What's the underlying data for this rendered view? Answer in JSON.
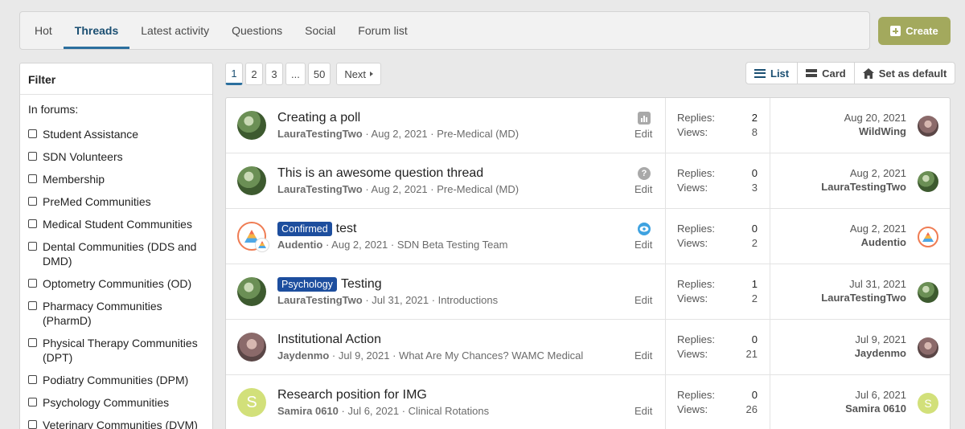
{
  "tabs": [
    {
      "label": "Hot",
      "active": false
    },
    {
      "label": "Threads",
      "active": true
    },
    {
      "label": "Latest activity",
      "active": false
    },
    {
      "label": "Questions",
      "active": false
    },
    {
      "label": "Social",
      "active": false
    },
    {
      "label": "Forum list",
      "active": false
    }
  ],
  "create_label": "Create",
  "filter": {
    "title": "Filter",
    "in_forums_label": "In forums:",
    "forums": [
      "Student Assistance",
      "SDN Volunteers",
      "Membership",
      "PreMed Communities",
      "Medical Student Communities",
      "Dental Communities (DDS and DMD)",
      "Optometry Communities (OD)",
      "Pharmacy Communities (PharmD)",
      "Physical Therapy Communities (DPT)",
      "Podiatry Communities (DPM)",
      "Psychology Communities",
      "Veterinary Communities (DVM)"
    ]
  },
  "pagination": {
    "pages": [
      "1",
      "2",
      "3",
      "...",
      "50"
    ],
    "current": "1",
    "next_label": "Next"
  },
  "view_switch": {
    "list_label": "List",
    "card_label": "Card",
    "default_label": "Set as default"
  },
  "threads": [
    {
      "title": "Creating a poll",
      "prefix": "",
      "author": "LauraTestingTwo",
      "date": "Aug 2, 2021",
      "forum": "Pre-Medical (MD)",
      "status_icon": "poll-icon",
      "edit_label": "Edit",
      "replies_label": "Replies:",
      "replies": "2",
      "views_label": "Views:",
      "views": "8",
      "last_date": "Aug 20, 2021",
      "last_user": "WildWing",
      "avatar": "green",
      "last_avatar": "person"
    },
    {
      "title": "This is an awesome question thread",
      "prefix": "",
      "author": "LauraTestingTwo",
      "date": "Aug 2, 2021",
      "forum": "Pre-Medical (MD)",
      "status_icon": "question-icon",
      "edit_label": "Edit",
      "replies_label": "Replies:",
      "replies": "0",
      "views_label": "Views:",
      "views": "3",
      "last_date": "Aug 2, 2021",
      "last_user": "LauraTestingTwo",
      "avatar": "green",
      "last_avatar": "green"
    },
    {
      "title": "test",
      "prefix": "Confirmed",
      "author": "Audentio",
      "date": "Aug 2, 2021",
      "forum": "SDN Beta Testing Team",
      "status_icon": "eye-icon",
      "edit_label": "Edit",
      "replies_label": "Replies:",
      "replies": "0",
      "views_label": "Views:",
      "views": "2",
      "last_date": "Aug 2, 2021",
      "last_user": "Audentio",
      "avatar": "audentio",
      "last_avatar": "audentio"
    },
    {
      "title": "Testing",
      "prefix": "Psychology",
      "author": "LauraTestingTwo",
      "date": "Jul 31, 2021",
      "forum": "Introductions",
      "status_icon": "",
      "edit_label": "Edit",
      "replies_label": "Replies:",
      "replies": "1",
      "views_label": "Views:",
      "views": "2",
      "last_date": "Jul 31, 2021",
      "last_user": "LauraTestingTwo",
      "avatar": "green",
      "last_avatar": "green"
    },
    {
      "title": "Institutional Action",
      "prefix": "",
      "author": "Jaydenmo",
      "date": "Jul 9, 2021",
      "forum": "What Are My Chances? WAMC Medical",
      "status_icon": "",
      "edit_label": "Edit",
      "replies_label": "Replies:",
      "replies": "0",
      "views_label": "Views:",
      "views": "21",
      "last_date": "Jul 9, 2021",
      "last_user": "Jaydenmo",
      "avatar": "person",
      "last_avatar": "person"
    },
    {
      "title": "Research position for IMG",
      "prefix": "",
      "author": "Samira 0610",
      "date": "Jul 6, 2021",
      "forum": "Clinical Rotations",
      "status_icon": "",
      "edit_label": "Edit",
      "replies_label": "Replies:",
      "replies": "0",
      "views_label": "Views:",
      "views": "26",
      "last_date": "Jul 6, 2021",
      "last_user": "Samira 0610",
      "avatar": "letter",
      "avatar_letter": "S",
      "last_avatar": "letter"
    }
  ]
}
